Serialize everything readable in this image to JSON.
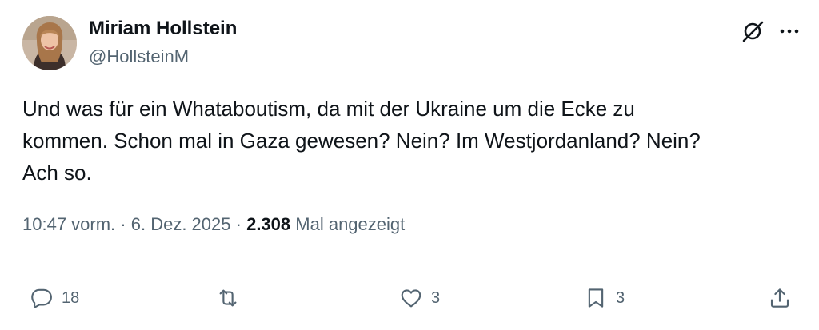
{
  "author": {
    "name": "Miriam Hollstein",
    "handle": "@HollsteinM"
  },
  "tweet": {
    "text": "Und was für ein Whataboutism, da mit der Ukraine um die Ecke zu\nkommen. Schon mal in Gaza gewesen? Nein? Im Westjordanland? Nein?\nAch so."
  },
  "meta": {
    "time": "10:47 vorm.",
    "separator": "·",
    "date": "6. Dez. 2025",
    "views_count": "2.308",
    "views_label": "Mal angezeigt"
  },
  "actions": {
    "reply_count": "18",
    "repost_count": "",
    "like_count": "3",
    "bookmark_count": "3"
  },
  "icons": {
    "grok": "grok-icon",
    "more": "more-icon",
    "reply": "reply-icon",
    "repost": "repost-icon",
    "like": "heart-icon",
    "bookmark": "bookmark-icon",
    "share": "share-icon"
  },
  "colors": {
    "text_primary": "#0f1419",
    "text_secondary": "#536471",
    "divider": "#eff3f4"
  }
}
